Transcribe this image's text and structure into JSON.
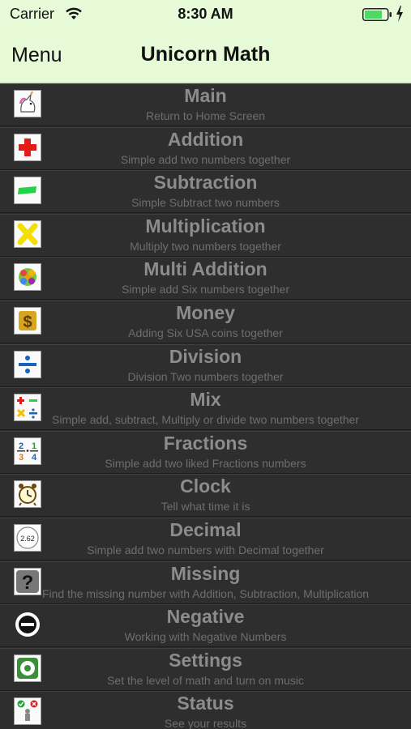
{
  "status_bar": {
    "carrier": "Carrier",
    "time": "8:30 AM"
  },
  "nav": {
    "menu_label": "Menu",
    "title": "Unicorn Math"
  },
  "menu_items": [
    {
      "title": "Main",
      "subtitle": "Return to Home Screen",
      "icon": "unicorn-icon"
    },
    {
      "title": "Addition",
      "subtitle": "Simple add two numbers together",
      "icon": "plus-icon"
    },
    {
      "title": "Subtraction",
      "subtitle": "Simple Subtract two numbers",
      "icon": "minus-icon"
    },
    {
      "title": "Multiplication",
      "subtitle": "Multiply two numbers together",
      "icon": "multiply-icon"
    },
    {
      "title": "Multi Addition",
      "subtitle": "Simple add Six numbers together",
      "icon": "multi-addition-icon"
    },
    {
      "title": "Money",
      "subtitle": "Adding Six USA coins together",
      "icon": "dollar-icon"
    },
    {
      "title": "Division",
      "subtitle": "Division Two numbers together",
      "icon": "division-icon"
    },
    {
      "title": "Mix",
      "subtitle": "Simple add, subtract, Multiply or divide two numbers together",
      "icon": "mix-operations-icon"
    },
    {
      "title": "Fractions",
      "subtitle": "Simple add two liked Fractions numbers",
      "icon": "fractions-icon"
    },
    {
      "title": "Clock",
      "subtitle": "Tell what time it is",
      "icon": "alarm-clock-icon"
    },
    {
      "title": "Decimal",
      "subtitle": "Simple add two numbers with Decimal together",
      "icon": "decimal-icon",
      "icon_text": "2.62"
    },
    {
      "title": "Missing",
      "subtitle": "Find the missing number with Addition, Subtraction, Multiplication",
      "icon": "question-mark-icon"
    },
    {
      "title": "Negative",
      "subtitle": "Working with Negative Numbers",
      "icon": "negative-icon"
    },
    {
      "title": "Settings",
      "subtitle": "Set the level of math and turn on music",
      "icon": "settings-icon"
    },
    {
      "title": "Status",
      "subtitle": "See your results",
      "icon": "status-icon"
    }
  ]
}
